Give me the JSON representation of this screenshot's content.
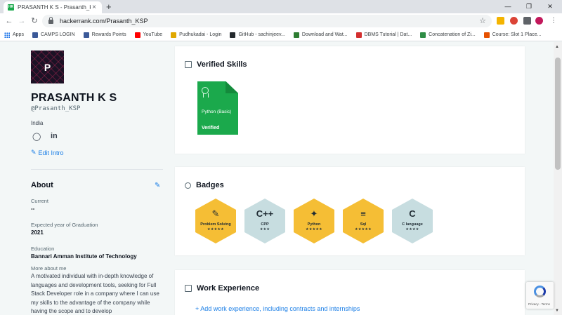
{
  "browser": {
    "tab_title": "PRASANTH K S - Prasanth_KSP | H",
    "tab_favicon": "HR",
    "url": "hackerrank.com/Prasanth_KSP",
    "bookmarks": [
      {
        "label": "Apps",
        "color": "#1a73e8",
        "icon": "apps-grid-icon"
      },
      {
        "label": "CAMPS LOGIN",
        "color": "#3b5998",
        "icon": "camps-icon"
      },
      {
        "label": "Rewards Points",
        "color": "#3b5998",
        "icon": "rewards-icon"
      },
      {
        "label": "YouTube",
        "color": "#ff0000",
        "icon": "youtube-icon"
      },
      {
        "label": "Pudhukadai - Login",
        "color": "#e0a800",
        "icon": "pudhukadai-icon"
      },
      {
        "label": "GitHub - sachinjeev...",
        "color": "#24292e",
        "icon": "github-icon"
      },
      {
        "label": "Download and Wat...",
        "color": "#2e7d32",
        "icon": "download-icon"
      },
      {
        "label": "DBMS Tutorial | Dat...",
        "color": "#d32f2f",
        "icon": "dbms-icon"
      },
      {
        "label": "Concatenation of Zi...",
        "color": "#2f8d46",
        "icon": "geeks-icon"
      },
      {
        "label": "Course: Slot 1 Place...",
        "color": "#e65100",
        "icon": "course-icon"
      }
    ]
  },
  "profile": {
    "avatar_letter": "P",
    "name": "PRASANTH K S",
    "handle": "@Prasanth_KSP",
    "country": "India",
    "edit_intro": "Edit Intro"
  },
  "about": {
    "title": "About",
    "current_label": "Current",
    "current_value": "--",
    "grad_label": "Expected year of Graduation",
    "grad_value": "2021",
    "edu_label": "Education",
    "edu_value": "Bannari Amman Institute of Technology",
    "more_label": "More about me",
    "bio": "A motivated individual with in-depth knowledge of languages and development tools, seeking for Full Stack Developer role in a company where I can use my skills to the advantage of the company while having the scope and to develop"
  },
  "verified_skills": {
    "title": "Verified Skills",
    "items": [
      {
        "skill": "Python (Basic)",
        "status": "Verified"
      }
    ]
  },
  "badges": {
    "title": "Badges",
    "items": [
      {
        "name": "Problem Solving",
        "stars": 5,
        "icon": "✎",
        "style": "gold"
      },
      {
        "name": "CPP",
        "stars": 3,
        "icon": "C++",
        "style": "grey"
      },
      {
        "name": "Python",
        "stars": 5,
        "icon": "✦",
        "style": "gold"
      },
      {
        "name": "Sql",
        "stars": 5,
        "icon": "≡",
        "style": "gold"
      },
      {
        "name": "C language",
        "stars": 4,
        "icon": "C",
        "style": "grey"
      }
    ]
  },
  "work_experience": {
    "title": "Work Experience",
    "add_label": "+ Add work experience, including contracts and internships"
  },
  "recaptcha": {
    "text": "Privacy - Terms"
  }
}
